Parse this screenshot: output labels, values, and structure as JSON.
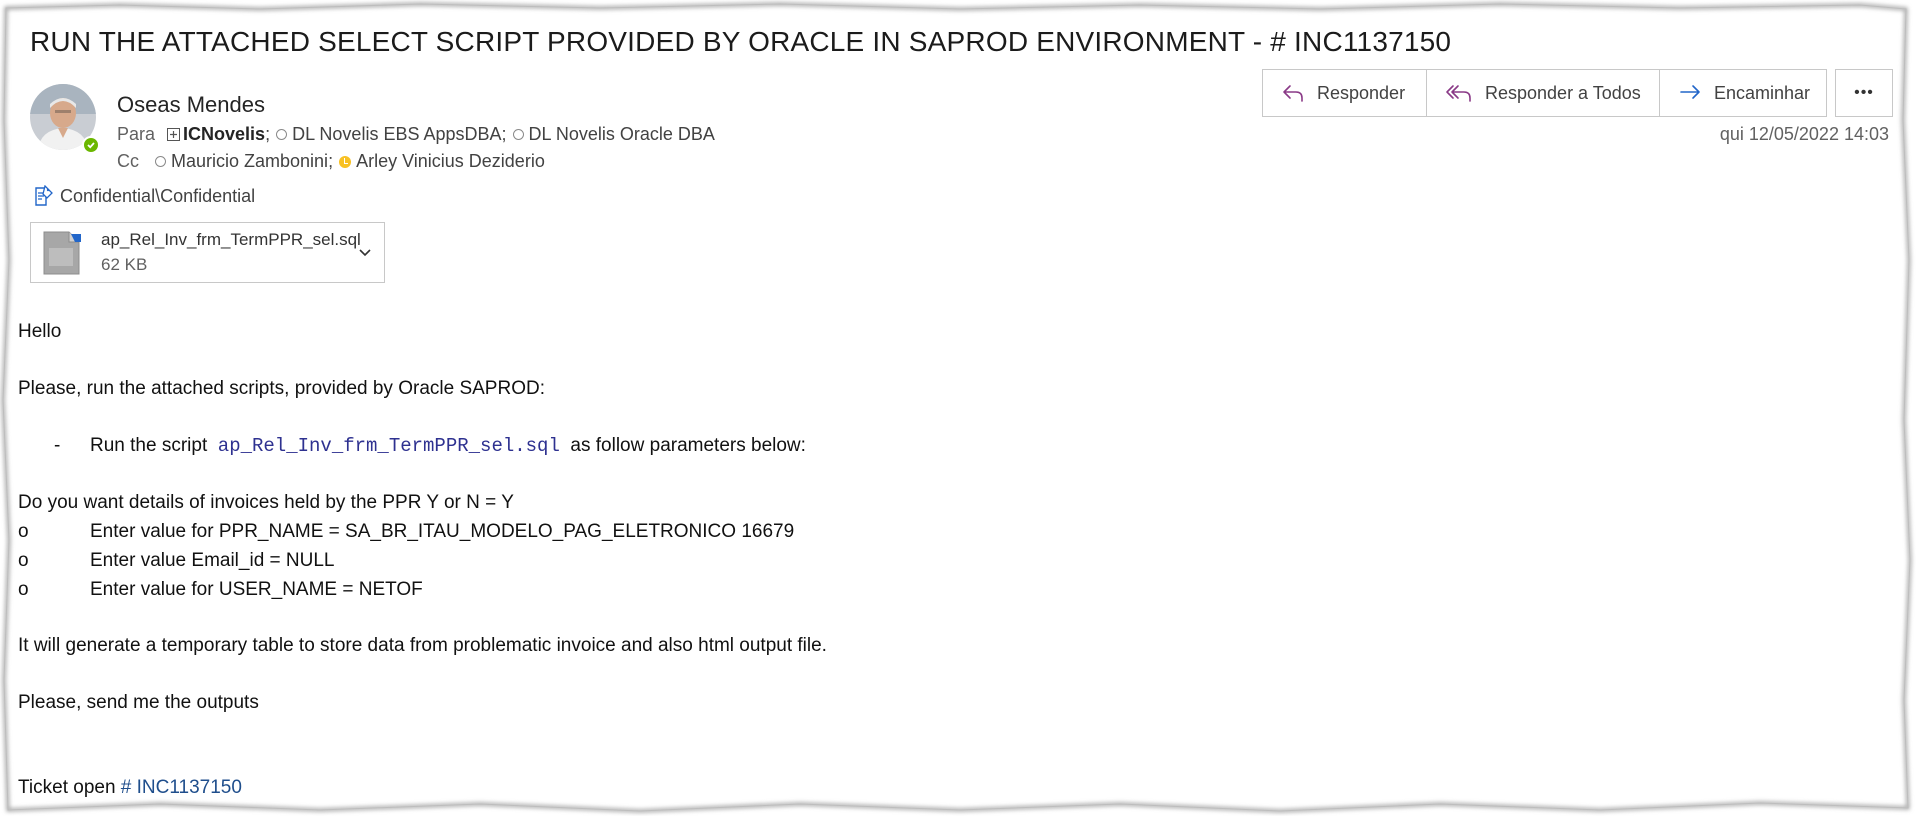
{
  "email": {
    "subject": "RUN THE ATTACHED SELECT SCRIPT PROVIDED BY ORACLE IN SAPROD ENVIRONMENT - # INC1137150",
    "sender": "Oseas Mendes",
    "to_label": "Para",
    "cc_label": "Cc",
    "to": [
      "ICNovelis",
      "DL Novelis EBS AppsDBA",
      "DL Novelis Oracle DBA"
    ],
    "cc": [
      "Mauricio Zambonini",
      "Arley Vinicius Deziderio"
    ],
    "separator": ";",
    "date": "qui 12/05/2022 14:03",
    "sensitivity": "Confidential\\Confidential"
  },
  "actions": {
    "reply": "Responder",
    "reply_all": "Responder a Todos",
    "forward": "Encaminhar",
    "more": "•••"
  },
  "attachment": {
    "name": "ap_Rel_Inv_frm_TermPPR_sel.sql",
    "size": "62 KB"
  },
  "body": {
    "greeting": "Hello",
    "intro": "Please,  run the attached scripts, provided by Oracle SAPROD:",
    "bullet_marker": "-",
    "bullet_prefix": "Run the script",
    "bullet_script": "ap_Rel_Inv_frm_TermPPR_sel.sql",
    "bullet_suffix": "as follow parameters below:",
    "question": "Do you want details of invoices held by the PPR Y or N =  Y",
    "param_marker": "o",
    "params": [
      "Enter value for PPR_NAME = SA_BR_ITAU_MODELO_PAG_ELETRONICO 16679",
      "Enter value Email_id = NULL",
      "Enter value for USER_NAME = NETOF"
    ],
    "generate": "It will generate a temporary table to store data from problematic invoice and also html output file.",
    "request": "Please, send me the outputs",
    "ticket_label": "Ticket open",
    "ticket_link": "# INC1137150"
  }
}
